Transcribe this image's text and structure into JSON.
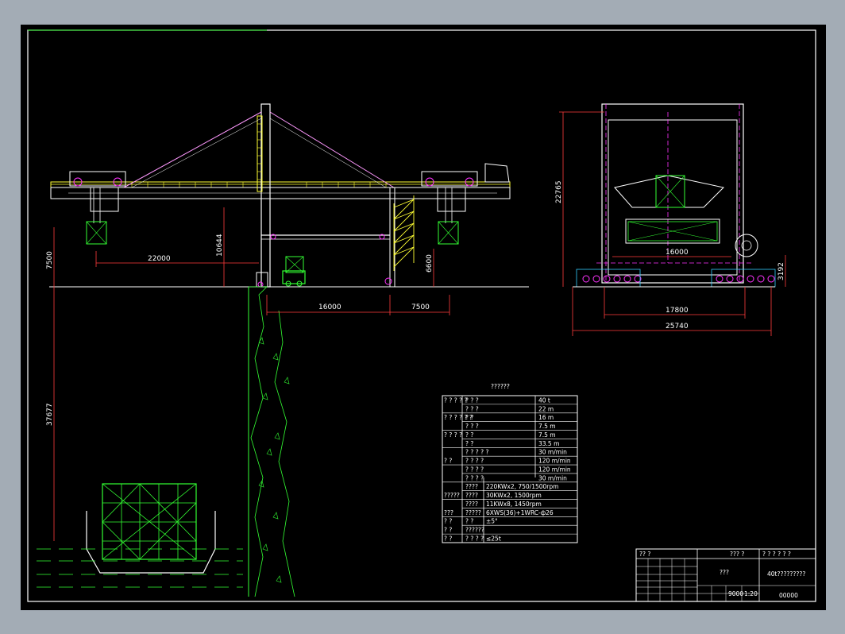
{
  "colors": {
    "page_bg": "#a3acb5",
    "canvas_bg": "#000000",
    "frame": "#ffffff",
    "structure": "#ffffff",
    "dimension": "#ff3b3b",
    "walkway": "#ffff33",
    "ground": "#33ff33",
    "accent": "#ff33ff",
    "cyan": "#33ccff"
  },
  "side_view": {
    "dims": {
      "outreach": "22000",
      "height_a": "10644",
      "clearance": "6600",
      "rail_gauge": "16000",
      "backreach": "7500",
      "tide_a": "7500",
      "tide_b": "37677"
    }
  },
  "end_view": {
    "dims": {
      "height": "22765",
      "inner_span": "16000",
      "outer_span": "17800",
      "overall": "25740",
      "base": "3192"
    }
  },
  "spec_table": {
    "title": "??????",
    "rows": [
      {
        "c1": "? ? ? ? ?",
        "c2": "?   ?   ?",
        "c3": "40  t"
      },
      {
        "c1": "",
        "c2": "?   ?   ?",
        "c3": "22  m"
      },
      {
        "c1": "? ? ? ? ? ?",
        "c2": "?      ?",
        "c3": "16  m"
      },
      {
        "c1": "",
        "c2": "?   ?   ?",
        "c3": "7.5  m"
      },
      {
        "c1": "? ? ? ?",
        "c2": "?      ?",
        "c3": "7.5  m"
      },
      {
        "c1": "",
        "c2": "?      ?",
        "c3": "33.5  m"
      },
      {
        "c1": "",
        "c2": "?   ? ? ? ?",
        "c3": "30  m/min"
      },
      {
        "c1": "?        ?",
        "c2": "?   ? ? ?",
        "c3": "120  m/min"
      },
      {
        "c1": "",
        "c2": "? ? ? ?",
        "c3": "120  m/min"
      },
      {
        "c1": "",
        "c2": "? ? ? ?",
        "c3": "30  m/min"
      },
      {
        "c1": "",
        "c2": "????",
        "c3": "220KWx2, 750/1500rpm"
      },
      {
        "c1": "?????",
        "c2": "????",
        "c3": "30KWx2, 1500rpm"
      },
      {
        "c1": "",
        "c2": "????",
        "c3": "11KWx8, 1450rpm"
      },
      {
        "c1": "???",
        "c2": "?????",
        "c3": "6XWS(36)+1WRC-ф26"
      },
      {
        "c1": "?     ?",
        "c2": "?   ?",
        "c3": "±5°"
      },
      {
        "c1": "?     ?",
        "c2": "??????",
        "c3": ""
      },
      {
        "c1": "?     ?",
        "c2": "? ? ? ?",
        "c3": "≤25t"
      }
    ]
  },
  "title_block": {
    "top_left": "?? ?",
    "top_mid": "??? ?",
    "top_right": "? ? ? ? ? ?",
    "name": "???",
    "drawing_title": "40t?????????",
    "scale": "9000",
    "ratio": "1:20",
    "code": "00000"
  }
}
